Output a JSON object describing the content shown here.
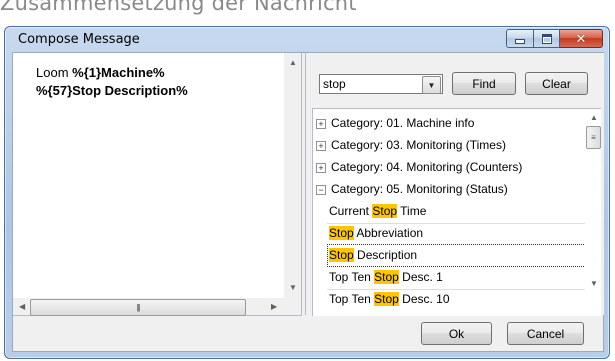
{
  "background_caption": "Zusammensetzung der Nachricht",
  "window": {
    "title": "Compose Message",
    "caption_buttons": {
      "minimize_icon": "minimize-icon",
      "maximize_icon": "maximize-icon",
      "close_icon": "close-icon"
    }
  },
  "message": {
    "prefix": "Loom ",
    "var1": "%{1}Machine%",
    "var2": "%{57}Stop Description%"
  },
  "search": {
    "value": "stop",
    "find_label": "Find",
    "clear_label": "Clear"
  },
  "tree": {
    "categories": [
      {
        "expander": "+",
        "label": "Category: 01. Machine info"
      },
      {
        "expander": "+",
        "label": "Category: 03. Monitoring (Times)"
      },
      {
        "expander": "+",
        "label": "Category: 04. Monitoring (Counters)"
      },
      {
        "expander": "−",
        "label": "Category: 05. Monitoring (Status)"
      }
    ],
    "items": [
      {
        "before": "Current ",
        "match": "Stop",
        "after": " Time"
      },
      {
        "before": "",
        "match": "Stop",
        "after": " Abbreviation"
      },
      {
        "before": "",
        "match": "Stop",
        "after": " Description",
        "selected": true
      },
      {
        "before": "Top Ten ",
        "match": "Stop",
        "after": " Desc. 1"
      },
      {
        "before": "Top Ten ",
        "match": "Stop",
        "after": " Desc. 10"
      }
    ],
    "highlight_color": "#ffc600"
  },
  "footer": {
    "ok_label": "Ok",
    "cancel_label": "Cancel"
  }
}
